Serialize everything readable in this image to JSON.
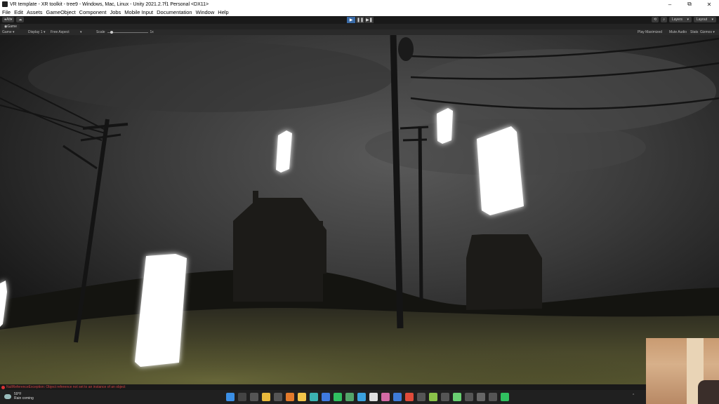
{
  "window": {
    "title": "VR template - XR toolkit - tree9 - Windows, Mac, Linux - Unity 2021.2.7f1 Personal <DX11>",
    "minimize": "–",
    "maximize": "⧉",
    "close": "✕"
  },
  "menu": [
    "File",
    "Edit",
    "Assets",
    "GameObject",
    "Component",
    "Jobs",
    "Mobile Input",
    "Documentation",
    "Window",
    "Help"
  ],
  "toolbar": {
    "account": "Alt",
    "play": "▶",
    "pause": "❚❚",
    "step": "▶❚",
    "layers": "Layers",
    "layout": "Layout"
  },
  "tab": {
    "label": "Game"
  },
  "gamebar": {
    "mode": "Game",
    "display": "Display 1",
    "aspect": "Free Aspect",
    "scale_label": "Scale",
    "scale_value": "1x",
    "play_mode": "Play Maximized",
    "mute": "Mute Audio",
    "stats": "Stats",
    "gizmos": "Gizmos"
  },
  "console": {
    "message": "NullReferenceException: Object reference not set to an instance of an object"
  },
  "taskbar": {
    "weather_temp": "59°F",
    "weather_desc": "Rain coming"
  },
  "colors": {
    "play_active": "#3a6aa5",
    "error": "#d04040"
  }
}
